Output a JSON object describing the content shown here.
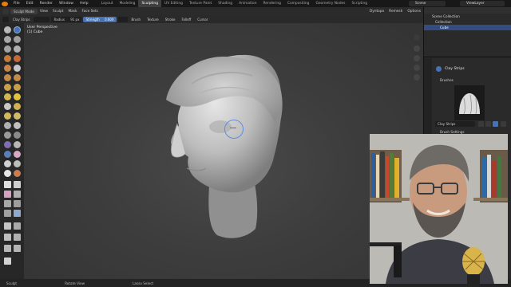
{
  "menu": {
    "items": [
      "File",
      "Edit",
      "Render",
      "Window",
      "Help"
    ]
  },
  "workspaces": {
    "tabs": [
      "Layout",
      "Modeling",
      "Sculpting",
      "UV Editing",
      "Texture Paint",
      "Shading",
      "Animation",
      "Rendering",
      "Compositing",
      "Geometry Nodes",
      "Scripting"
    ],
    "active": "Sculpting"
  },
  "scene": {
    "scene_name": "Scene",
    "view_layer": "ViewLayer"
  },
  "header": {
    "mode": "Sculpt Mode",
    "menus": [
      "View",
      "Sculpt",
      "Mask",
      "Face Sets"
    ],
    "right_items": [
      "Dyntopo",
      "Remesh",
      "Options"
    ]
  },
  "tool_settings": {
    "brush": "Clay Strips",
    "radius_label": "Radius",
    "radius_value": "91 px",
    "strength_label": "Strength",
    "strength_value": "0.600",
    "dropdowns": [
      "Brush",
      "Texture",
      "Stroke",
      "Falloff",
      "Cursor"
    ]
  },
  "viewport": {
    "perspective": "User Perspective",
    "object": "(1) Cube"
  },
  "outliner": {
    "rows": [
      "Scene Collection",
      "Collection",
      "Cube"
    ],
    "selected": "Cube"
  },
  "properties": {
    "brush_name": "Clay Strips",
    "brushes_panel": "Brushes",
    "brush_settings_panel": "Brush Settings",
    "brush_field": "Clay Strips"
  },
  "statusbar": {
    "items": [
      "Sculpt",
      "Rotate View",
      "Lasso Select"
    ]
  },
  "colors": {
    "accent": "#4772b3",
    "active_tab": "#3f3f3f",
    "viewport": "#3d3d3d",
    "selected": "#334d80",
    "blender_orange": "#e87d0d"
  }
}
